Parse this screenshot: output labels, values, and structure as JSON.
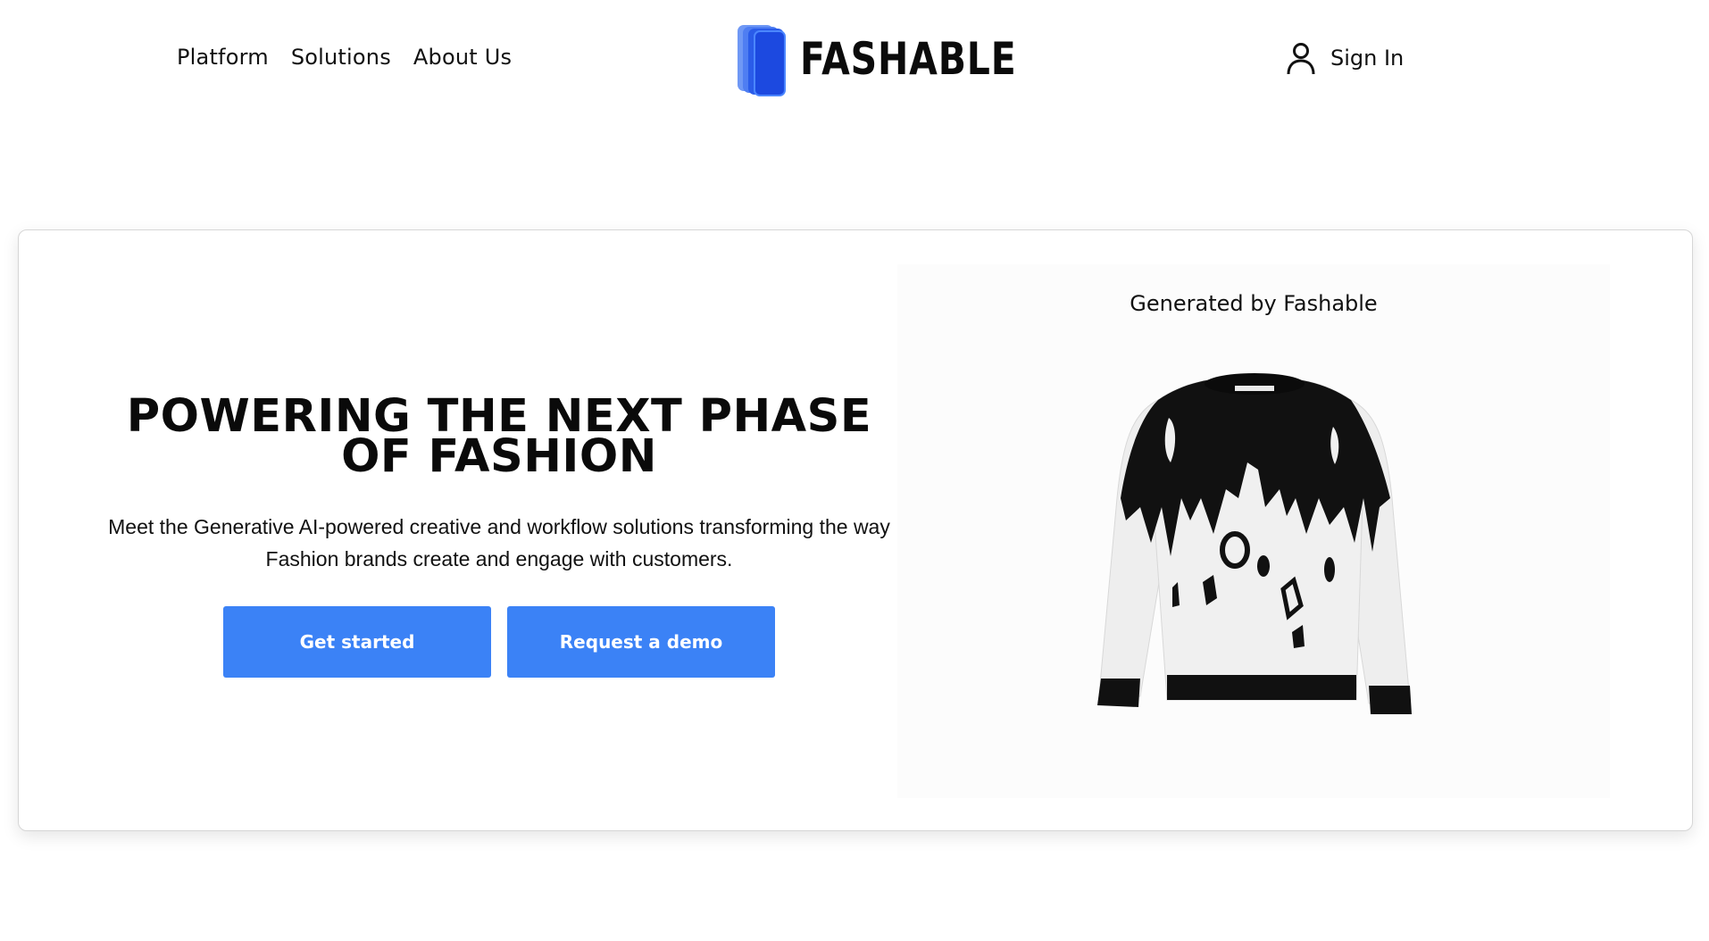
{
  "nav": {
    "links": [
      "Platform",
      "Solutions",
      "About Us"
    ],
    "brand": "FASHABLE",
    "signin": "Sign In"
  },
  "hero": {
    "title": "POWERING THE NEXT PHASE OF FASHION",
    "subtitle": "Meet the Generative AI-powered creative and workflow solutions transforming the way Fashion brands create and engage with customers.",
    "primary_button": "Get started",
    "secondary_button": "Request a demo"
  },
  "showcase": {
    "caption": "Generated by Fashable"
  },
  "colors": {
    "accent": "#3b82f6",
    "logo_blue": "#1c49e0"
  },
  "icons": [
    "user-icon",
    "logo-mark-icon"
  ]
}
